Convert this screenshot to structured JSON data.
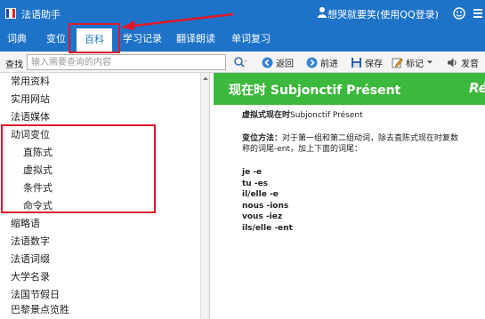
{
  "window": {
    "app_title": "法语助手",
    "user_text": "想哭就要笑(使用QQ登录)",
    "logo_colors": [
      "#1a4ba8",
      "#ffffff",
      "#d8202a"
    ]
  },
  "tabs": [
    {
      "label": "词典",
      "active": false
    },
    {
      "label": "变位",
      "active": false
    },
    {
      "label": "百科",
      "active": true
    },
    {
      "label": "学习记录",
      "active": false
    },
    {
      "label": "翻译朗读",
      "active": false
    },
    {
      "label": "单词复习",
      "active": false
    }
  ],
  "toolbar": {
    "search_label": "查找",
    "search_placeholder": "输入需要查询的内容",
    "back_label": "返回",
    "forward_label": "前进",
    "save_label": "保存",
    "mark_label": "标记",
    "pronounce_label": "发音"
  },
  "sidebar": {
    "items": [
      {
        "label": "常用资料",
        "level": 0
      },
      {
        "label": "实用网站",
        "level": 0
      },
      {
        "label": "法语媒体",
        "level": 0
      },
      {
        "label": "动词变位",
        "level": 0
      },
      {
        "label": "直陈式",
        "level": 1
      },
      {
        "label": "虚拟式",
        "level": 1
      },
      {
        "label": "条件式",
        "level": 1
      },
      {
        "label": "命令式",
        "level": 1
      },
      {
        "label": "缩略语",
        "level": 0
      },
      {
        "label": "法语数字",
        "level": 0
      },
      {
        "label": "法语词缀",
        "level": 0
      },
      {
        "label": "大学名录",
        "level": 0
      },
      {
        "label": "法国节假日",
        "level": 0
      },
      {
        "label": "巴黎景点览胜",
        "level": 0
      }
    ]
  },
  "content": {
    "header_title": "现在时 Subjonctif Présent",
    "header_title_right": "Ré",
    "tense_label": "虚拟式现在时",
    "tense_name": "Subjonctif Présent",
    "method_label": "变位方法：",
    "method_text_1": "对于第一组和第二组动词，除去直陈式现在时复数",
    "method_text_2": "称的词尾-ent，加上下面的词尾：",
    "endings": [
      "je -e",
      "tu -es",
      "il/elle -e",
      "nous -ions",
      "vous -iez",
      "ils/elle -ent"
    ]
  },
  "colors": {
    "titlebar_blue": "#1e73c8",
    "header_green": "#3cb93c",
    "annotation_red": "#e0182b"
  }
}
